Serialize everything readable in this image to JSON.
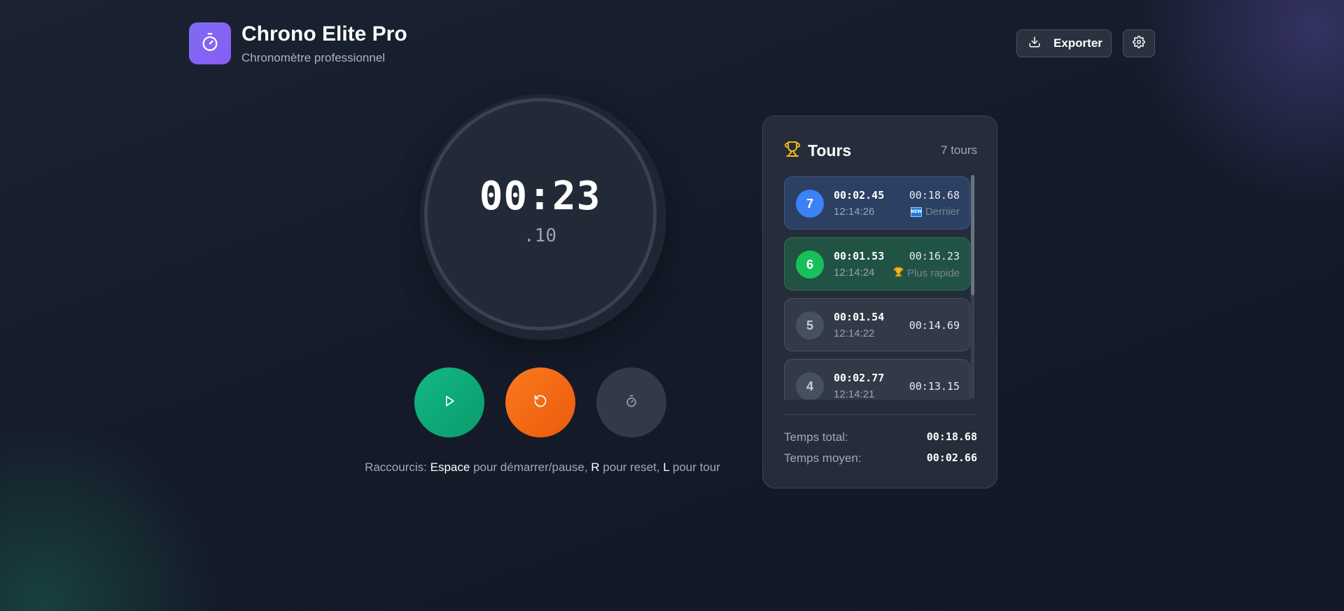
{
  "app": {
    "title": "Chrono Elite Pro",
    "subtitle": "Chronomètre professionnel",
    "logo_icon": "stopwatch-icon",
    "accent": "#8b5cf6"
  },
  "header": {
    "export_label": "Exporter",
    "export_icon": "download-icon",
    "settings_icon": "gear-icon"
  },
  "timer": {
    "main": "00:23",
    "centiseconds": ".10"
  },
  "controls": {
    "play_icon": "play-icon",
    "play_color": "#10b981",
    "reset_icon": "reset-icon",
    "reset_color": "#f97316",
    "lap_icon": "stopwatch-icon"
  },
  "shortcuts": {
    "prefix": "Raccourcis:",
    "key1": "Espace",
    "text1": "pour démarrer/pause,",
    "key2": "R",
    "text2": "pour reset,",
    "key3": "L",
    "text3": "pour tour"
  },
  "laps_panel": {
    "title": "Tours",
    "title_icon": "trophy-icon",
    "count_label": "7 tours",
    "laps": [
      {
        "number": "7",
        "lap_time": "00:02.45",
        "clock": "12:14:26",
        "total": "00:18.68",
        "badge": "Dernier",
        "badge_icon": "new-icon",
        "badge_icon_text": "NEW",
        "status": "last"
      },
      {
        "number": "6",
        "lap_time": "00:01.53",
        "clock": "12:14:24",
        "total": "00:16.23",
        "badge": "Plus rapide",
        "badge_icon": "trophy-icon",
        "status": "fastest"
      },
      {
        "number": "5",
        "lap_time": "00:01.54",
        "clock": "12:14:22",
        "total": "00:14.69"
      },
      {
        "number": "4",
        "lap_time": "00:02.77",
        "clock": "12:14:21",
        "total": "00:13.15"
      }
    ],
    "total_label": "Temps total:",
    "total_value": "00:18.68",
    "average_label": "Temps moyen:",
    "average_value": "00:02.66"
  }
}
